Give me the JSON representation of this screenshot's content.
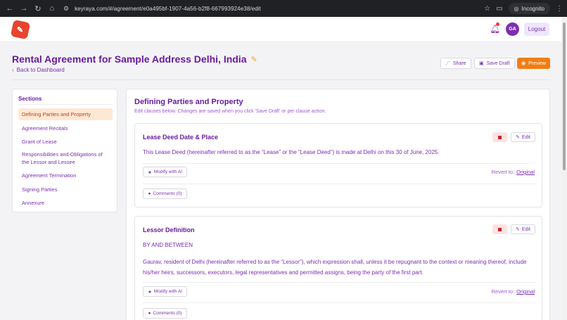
{
  "browser": {
    "url": "keyraya.com/#/agreement/e0a495bf-1907-4a56-b2f8-667993924e38/edit",
    "incognito_label": "Incognito"
  },
  "header": {
    "avatar_initials": "GA",
    "logout_label": "Logout"
  },
  "page": {
    "title": "Rental Agreement for Sample Address Delhi, India",
    "back_label": "Back to Dashboard",
    "share_label": "Share",
    "save_draft_label": "Save Draft",
    "preview_label": "Preview"
  },
  "sidebar": {
    "title": "Sections",
    "items": [
      {
        "label": "Defining Parties and Property",
        "active": true
      },
      {
        "label": "Agreement Recitals"
      },
      {
        "label": "Grant of Lease"
      },
      {
        "label": "Responsibilities and Obligations of the Lessor and Lessee"
      },
      {
        "label": "Agreement Termination"
      },
      {
        "label": "Signing Parties"
      },
      {
        "label": "Annexure"
      }
    ]
  },
  "main": {
    "title": "Defining Parties and Property",
    "subtitle": "Edit clauses below. Changes are saved when you click 'Save Draft' or per clause action.",
    "clauses": [
      {
        "title": "Lease Deed Date & Place",
        "edit_label": "Edit",
        "text": "This Lease Deed (hereinafter referred to as the “Lease” or the “Lease Deed”) is made at Delhi on this 30 of June, 2025.",
        "ai_label": "Modify with AI",
        "revert_label": "Revert to:",
        "original_label": "Original",
        "comments_label": "Comments (0)"
      },
      {
        "title": "Lessor Definition",
        "edit_label": "Edit",
        "text_line1": "BY AND BETWEEN",
        "text": "Gaurav, resident of Delhi (hereinafter referred to as the “Lessor”), which expression shall, unless it be repugnant to the context or meaning thereof, include his/her heirs, successors, executors, legal representatives and permitted assigns, being the party of the first part.",
        "ai_label": "Modify with AI",
        "revert_label": "Revert to:",
        "original_label": "Original",
        "comments_label": "Comments (0)"
      }
    ]
  },
  "colors": {
    "brand_purple": "#6a1b9a",
    "accent_orange": "#f07e16",
    "logo_red": "#e8442f"
  }
}
